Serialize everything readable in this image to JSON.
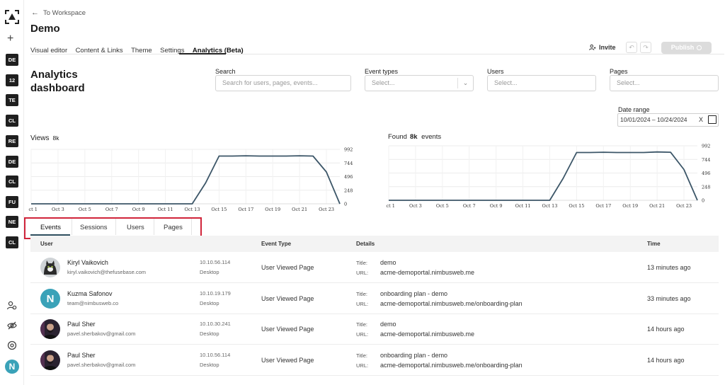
{
  "rail": {
    "chips": [
      "DE",
      "12",
      "TE",
      "CL",
      "RE",
      "DE",
      "CL",
      "FU",
      "NE",
      "CL"
    ],
    "add_symbol": "+",
    "bottom_icons": [
      "users-icon",
      "eye-off-icon",
      "settings-icon"
    ],
    "avatar_letter": "N"
  },
  "header": {
    "back_label": "To Workspace",
    "title": "Demo",
    "tabs": [
      {
        "label": "Visual editor",
        "active": false
      },
      {
        "label": "Content & Links",
        "active": false
      },
      {
        "label": "Theme",
        "active": false
      },
      {
        "label": "Settings",
        "active": false
      },
      {
        "label": "Analytics (Beta)",
        "active": true
      }
    ],
    "invite_label": "Invite",
    "publish_label": "Publish"
  },
  "filters": {
    "dashboard_title": "Analytics dashboard",
    "search": {
      "label": "Search",
      "placeholder": "Search for users, pages, events..."
    },
    "event_types": {
      "label": "Event types",
      "placeholder": "Select..."
    },
    "users": {
      "label": "Users",
      "placeholder": "Select..."
    },
    "pages": {
      "label": "Pages",
      "placeholder": "Select..."
    },
    "date_range": {
      "label": "Date range",
      "value": "10/01/2024 – 10/24/2024",
      "clear": "X"
    }
  },
  "views_chart": {
    "label": "Views",
    "count": "8k"
  },
  "events_chart": {
    "label_prefix": "Found",
    "count": "8k",
    "label_suffix": "events"
  },
  "chart_data": [
    {
      "type": "line",
      "title": "Views",
      "x_ticks": [
        "Oct 1",
        "Oct 3",
        "Oct 5",
        "Oct 7",
        "Oct 9",
        "Oct 11",
        "Oct 13",
        "Oct 15",
        "Oct 17",
        "Oct 19",
        "Oct 21",
        "Oct 23"
      ],
      "y_ticks": [
        0,
        248,
        496,
        744,
        992
      ],
      "ylim": [
        0,
        992
      ],
      "x": [
        1,
        2,
        3,
        4,
        5,
        6,
        7,
        8,
        9,
        10,
        11,
        12,
        13,
        14,
        15,
        16,
        17,
        18,
        19,
        20,
        21,
        22,
        23,
        24
      ],
      "values": [
        0,
        0,
        0,
        0,
        0,
        0,
        0,
        0,
        0,
        0,
        0,
        0,
        0,
        380,
        870,
        870,
        875,
        870,
        870,
        870,
        875,
        870,
        580,
        0
      ],
      "color": "#3c5668"
    },
    {
      "type": "line",
      "title": "Found 8k events",
      "x_ticks": [
        "Oct 1",
        "Oct 3",
        "Oct 5",
        "Oct 7",
        "Oct 9",
        "Oct 11",
        "Oct 13",
        "Oct 15",
        "Oct 17",
        "Oct 19",
        "Oct 21",
        "Oct 23"
      ],
      "y_ticks": [
        0,
        248,
        496,
        744,
        992
      ],
      "ylim": [
        0,
        992
      ],
      "x": [
        1,
        2,
        3,
        4,
        5,
        6,
        7,
        8,
        9,
        10,
        11,
        12,
        13,
        14,
        15,
        16,
        17,
        18,
        19,
        20,
        21,
        22,
        23,
        24
      ],
      "values": [
        0,
        0,
        0,
        0,
        0,
        0,
        0,
        0,
        0,
        0,
        0,
        0,
        0,
        400,
        870,
        870,
        875,
        870,
        870,
        870,
        880,
        875,
        560,
        0
      ],
      "color": "#3c5668"
    }
  ],
  "table": {
    "tabs": [
      "Events",
      "Sessions",
      "Users",
      "Pages"
    ],
    "active_tab": "Events",
    "columns": {
      "user": "User",
      "event_type": "Event Type",
      "details": "Details",
      "time": "Time"
    },
    "title_label": "Title:",
    "url_label": "URL:",
    "rows": [
      {
        "name": "Kiryl Vaikovich",
        "email": "kiryl.vaikovich@thefusebase.com",
        "ip": "10.10.56.114",
        "device": "Desktop",
        "event": "User Viewed Page",
        "title": "demo",
        "url": "acme-demoportal.nimbusweb.me",
        "time": "13 minutes ago",
        "avatar": "cat-avatar"
      },
      {
        "name": "Kuzma Safonov",
        "email": "team@nimbusweb.co",
        "ip": "10.10.19.179",
        "device": "Desktop",
        "event": "User Viewed Page",
        "title": "onboarding plan - demo",
        "url": "acme-demoportal.nimbusweb.me/onboarding-plan",
        "time": "33 minutes ago",
        "avatar": "n-logo-avatar"
      },
      {
        "name": "Paul Sher",
        "email": "pavel.sherbakov@gmail.com",
        "ip": "10.10.30.241",
        "device": "Desktop",
        "event": "User Viewed Page",
        "title": "demo",
        "url": "acme-demoportal.nimbusweb.me",
        "time": "14 hours ago",
        "avatar": "person-avatar"
      },
      {
        "name": "Paul Sher",
        "email": "pavel.sherbakov@gmail.com",
        "ip": "10.10.56.114",
        "device": "Desktop",
        "event": "User Viewed Page",
        "title": "onboarding plan - demo",
        "url": "acme-demoportal.nimbusweb.me/onboarding-plan",
        "time": "14 hours ago",
        "avatar": "person-avatar"
      }
    ]
  }
}
